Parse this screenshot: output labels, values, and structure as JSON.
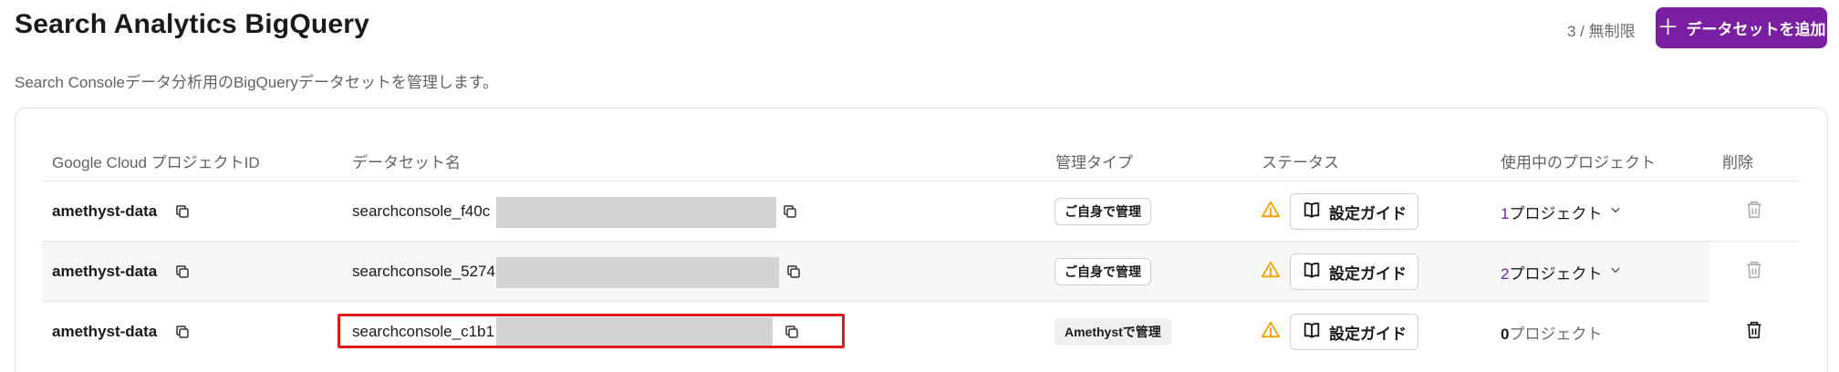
{
  "header": {
    "title": "Search Analytics BigQuery",
    "subtitle": "Search Consoleデータ分析用のBigQueryデータセットを管理します。",
    "quota": "3 / 無制限",
    "add_button_label": "データセットを追加",
    "add_button_icon": "plus-icon"
  },
  "colors": {
    "accent": "#7b1fa2",
    "warning": "#f2a100",
    "highlight_border": "#e0191a"
  },
  "table": {
    "columns": [
      "Google Cloud プロジェクトID",
      "データセット名",
      "管理タイプ",
      "ステータス",
      "使用中のプロジェクト",
      "削除"
    ],
    "rows": [
      {
        "project_id": "amethyst-data",
        "dataset": "searchconsole_f40c",
        "management": "ご自身で管理",
        "guide_label": "設定ガイド",
        "projects_count": "1",
        "projects_label": "プロジェクト"
      },
      {
        "project_id": "amethyst-data",
        "dataset": "searchconsole_5274",
        "management": "ご自身で管理",
        "guide_label": "設定ガイド",
        "projects_count": "2",
        "projects_label": "プロジェクト"
      },
      {
        "project_id": "amethyst-data",
        "dataset": "searchconsole_c1b1",
        "management": "Amethystで管理",
        "guide_label": "設定ガイド",
        "projects_count": "0",
        "projects_label": "プロジェクト"
      }
    ]
  }
}
